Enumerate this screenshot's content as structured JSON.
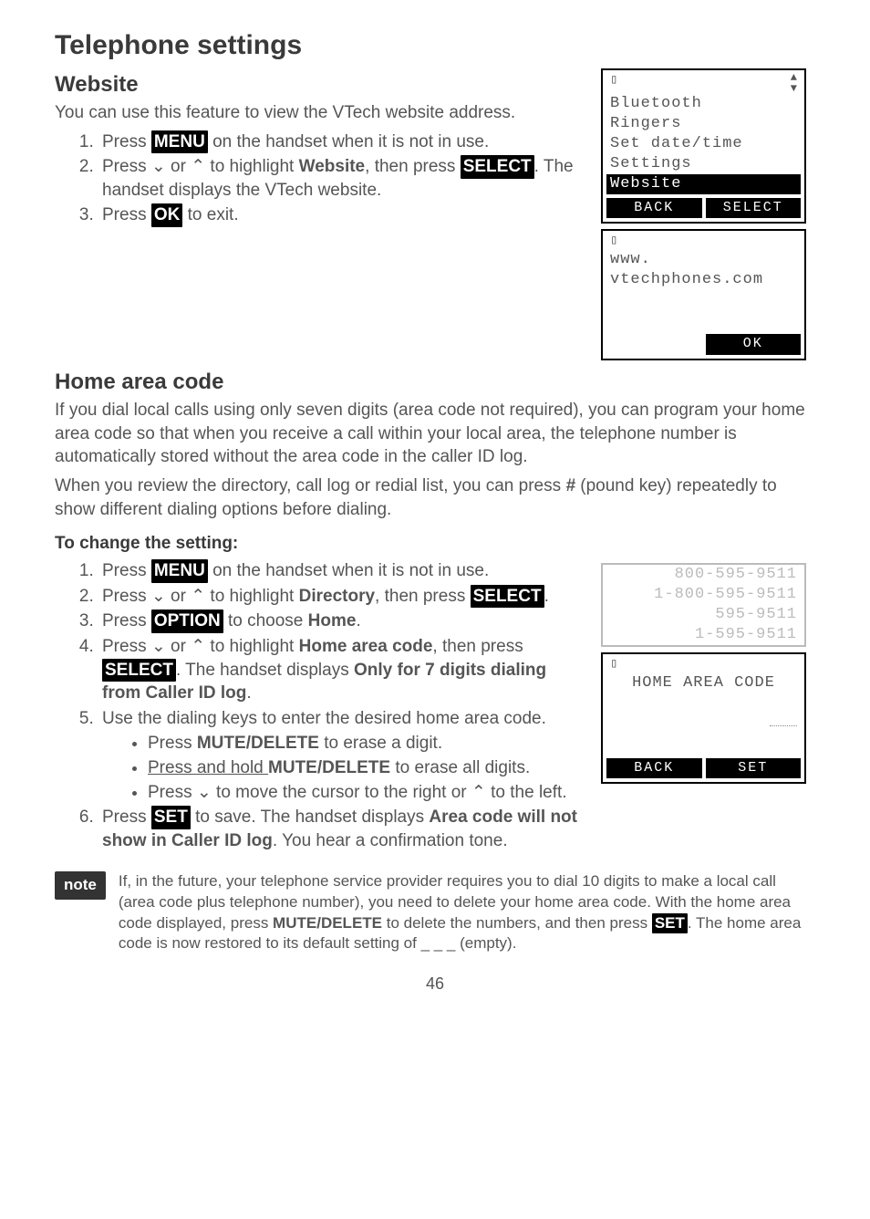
{
  "page": {
    "title": "Telephone settings",
    "pageNumber": "46"
  },
  "website": {
    "heading": "Website",
    "intro": "You can use this feature to view the VTech website address.",
    "step1_a": "Press ",
    "step1_btn": "MENU",
    "step1_b": " on the handset when it is not in use.",
    "step2_a": "Press ",
    "step2_b": " or ",
    "step2_c": " to highlight ",
    "step2_d": "Website",
    "step2_e": ", then press ",
    "step2_btn": "SELECT",
    "step2_f": ". The handset displays the VTech website.",
    "step3_a": "Press ",
    "step3_btn": "OK",
    "step3_b": " to exit."
  },
  "screen_menu": {
    "l1": "Bluetooth",
    "l2": "Ringers",
    "l3": "Set date/time",
    "l4": "Settings",
    "l5": "Website",
    "softL": "BACK",
    "softR": "SELECT"
  },
  "screen_web": {
    "l1": "www.",
    "l2": "vtechphones.com",
    "softR": "OK"
  },
  "home": {
    "heading": "Home area code",
    "p1": "If you dial local calls using only seven digits (area code not required), you can program your home area code so that when you receive a call within your local area, the telephone number is automatically stored without the area code in the caller ID log.",
    "p2a": "When you review the directory, call log or redial list, you can press ",
    "p2b": "#",
    "p2c": " (pound key) repeatedly to show different dialing options before dialing.",
    "changeHeading": "To change the setting:",
    "s1a": "Press ",
    "s1btn": "MENU",
    "s1b": " on the handset when it is not in use.",
    "s2a": "Press ",
    "s2b": " or ",
    "s2c": " to highlight ",
    "s2d": "Directory",
    "s2e": ", then press ",
    "s2btn": "SELECT",
    "s2f": ".",
    "s3a": "Press ",
    "s3btn": "OPTION",
    "s3b": " to choose ",
    "s3c": "Home",
    "s3d": ".",
    "s4a": "Press ",
    "s4b": " or ",
    "s4c": " to highlight ",
    "s4d": "Home area code",
    "s4e": ", then press ",
    "s4btn": "SELECT",
    "s4f": ". The handset displays ",
    "s4g": "Only for 7 digits dialing from Caller ID log",
    "s4h": ".",
    "s5": "Use the dialing keys to enter the desired home area code.",
    "s5b1a": "Press ",
    "s5b1m": "MUTE",
    "s5b1d": "/DELETE",
    "s5b1b": " to erase a digit.",
    "s5b2a": "Press and hold ",
    "s5b2m": "MUTE",
    "s5b2d": "/DELETE",
    "s5b2b": " to erase all digits.",
    "s5b3a": "Press ",
    "s5b3b": " to move the cursor to the right or ",
    "s5b3c": " to the left.",
    "s6a": "Press ",
    "s6btn": "SET",
    "s6b": " to save. The handset displays ",
    "s6c": "Area code will not show in Caller ID log",
    "s6d": ". You hear a confirmation tone."
  },
  "screen_dial": {
    "l1": "800-595-9511",
    "l2": "1-800-595-9511",
    "l3": "595-9511",
    "l4": "1-595-9511"
  },
  "screen_hac": {
    "l1": "HOME AREA CODE",
    "softL": "BACK",
    "softR": "SET"
  },
  "note": {
    "label": "note",
    "t1": "If, in the future, your telephone service provider requires you to dial 10 digits to make a local call (area code plus telephone number), you need to delete your home area code. With the home area code displayed, press ",
    "t2m": "MUTE",
    "t2d": "/DELETE",
    "t2": " to delete the numbers, and then press ",
    "t2btn": "SET",
    "t3": ". The home area code is now restored to its default setting of _ _ _ (empty)."
  }
}
